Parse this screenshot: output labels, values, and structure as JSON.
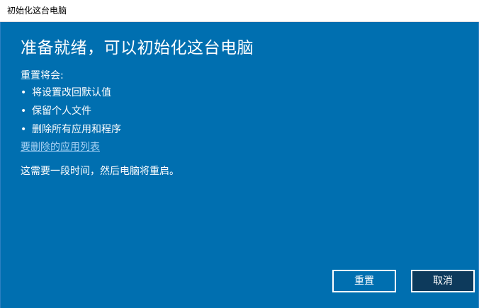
{
  "window": {
    "title": "初始化这台电脑"
  },
  "main": {
    "heading": "准备就绪，可以初始化这台电脑",
    "section_label": "重置将会:",
    "bullets": [
      "将设置改回默认值",
      "保留个人文件",
      "删除所有应用和程序"
    ],
    "bullet_glyph": "•",
    "link_text": "要删除的应用列表",
    "note": "这需要一段时间，然后电脑将重启。"
  },
  "buttons": {
    "reset_label": "重置",
    "cancel_label": "取消"
  },
  "colors": {
    "background": "#006fb0",
    "link": "#a9d3f5",
    "cancel_button": "#0d3a5c"
  }
}
